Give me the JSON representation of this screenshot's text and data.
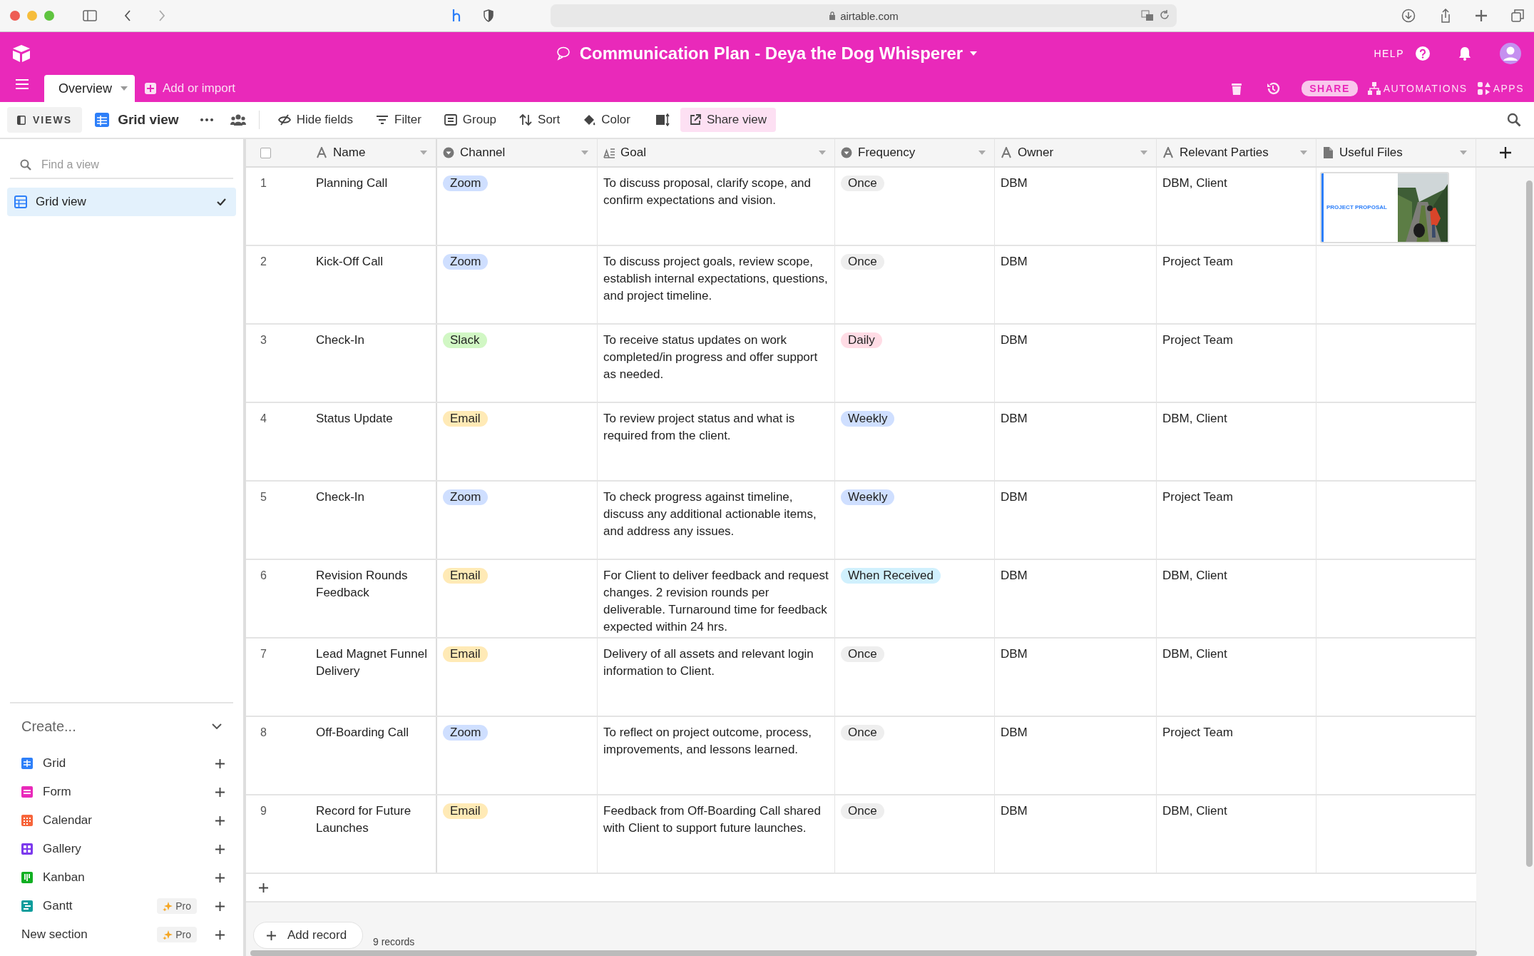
{
  "browser": {
    "url": "airtable.com"
  },
  "header": {
    "title": "Communication Plan - Deya the Dog Whisperer",
    "help": "HELP"
  },
  "tabs": [
    {
      "label": "Overview",
      "selected": true
    }
  ],
  "add_import": "Add or import",
  "header_actions": {
    "share": "SHARE",
    "automations": "AUTOMATIONS",
    "apps": "APPS"
  },
  "toolbar": {
    "views": "VIEWS",
    "view_name": "Grid view",
    "items": [
      {
        "label": "Hide fields",
        "kind": "hide"
      },
      {
        "label": "Filter",
        "kind": "filter"
      },
      {
        "label": "Group",
        "kind": "group"
      },
      {
        "label": "Sort",
        "kind": "sort"
      },
      {
        "label": "Color",
        "kind": "color"
      }
    ],
    "share_view": "Share view"
  },
  "sidebar": {
    "search_placeholder": "Find a view",
    "views": [
      {
        "label": "Grid view",
        "selected": true
      }
    ],
    "create_label": "Create...",
    "create_items": [
      {
        "label": "Grid",
        "kind": "grid",
        "color": "#2d7ff9"
      },
      {
        "label": "Form",
        "kind": "form",
        "color": "#e929ba"
      },
      {
        "label": "Calendar",
        "kind": "calendar",
        "color": "#f7653b"
      },
      {
        "label": "Gallery",
        "kind": "gallery",
        "color": "#7c39ed"
      },
      {
        "label": "Kanban",
        "kind": "kanban",
        "color": "#11af22"
      },
      {
        "label": "Gantt",
        "kind": "gantt",
        "color": "#0d9d9c",
        "badge": "Pro"
      },
      {
        "label": "New section",
        "kind": "section",
        "badge": "Pro"
      }
    ]
  },
  "table": {
    "select_all": {
      "checked": false
    },
    "columns": [
      {
        "label": "Name",
        "kind": "text"
      },
      {
        "label": "Channel",
        "kind": "select"
      },
      {
        "label": "Goal",
        "kind": "longtext"
      },
      {
        "label": "Frequency",
        "kind": "select"
      },
      {
        "label": "Owner",
        "kind": "text"
      },
      {
        "label": "Relevant Parties",
        "kind": "text"
      },
      {
        "label": "Useful Files",
        "kind": "attachment"
      }
    ],
    "rows": [
      {
        "number": "1",
        "name": "Planning Call",
        "channel": {
          "label": "Zoom",
          "color": "#cfdfff"
        },
        "goal": "To discuss proposal, clarify scope, and confirm expectations and vision.",
        "frequency": {
          "label": "Once",
          "color": "#eeeeee"
        },
        "owner": "DBM",
        "parties": "DBM, Client",
        "file": {
          "title": "PROJECT PROPOSAL"
        }
      },
      {
        "number": "2",
        "name": "Kick-Off Call",
        "channel": {
          "label": "Zoom",
          "color": "#cfdfff"
        },
        "goal": "To discuss project goals, review scope, establish internal expectations, questions, and project timeline.",
        "frequency": {
          "label": "Once",
          "color": "#eeeeee"
        },
        "owner": "DBM",
        "parties": "Project Team"
      },
      {
        "number": "3",
        "name": "Check-In",
        "channel": {
          "label": "Slack",
          "color": "#d1f7c4"
        },
        "goal": "To receive status updates on work completed/in progress and offer support as needed.",
        "frequency": {
          "label": "Daily",
          "color": "#ffdce5"
        },
        "owner": "DBM",
        "parties": "Project Team"
      },
      {
        "number": "4",
        "name": "Status Update",
        "channel": {
          "label": "Email",
          "color": "#ffeab6"
        },
        "goal": "To review project status and what is required from the client.",
        "frequency": {
          "label": "Weekly",
          "color": "#cfdfff"
        },
        "owner": "DBM",
        "parties": "DBM, Client"
      },
      {
        "number": "5",
        "name": "Check-In",
        "channel": {
          "label": "Zoom",
          "color": "#cfdfff"
        },
        "goal": "To check progress against timeline, discuss any additional actionable items, and address any issues.",
        "frequency": {
          "label": "Weekly",
          "color": "#cfdfff"
        },
        "owner": "DBM",
        "parties": "Project Team"
      },
      {
        "number": "6",
        "name": "Revision Rounds Feedback",
        "channel": {
          "label": "Email",
          "color": "#ffeab6"
        },
        "goal": "For Client to deliver feedback and request changes. 2 revision rounds per deliverable. Turnaround time for feedback expected within 24 hrs.",
        "frequency": {
          "label": "When Received",
          "color": "#d0f0fd"
        },
        "owner": "DBM",
        "parties": "DBM, Client"
      },
      {
        "number": "7",
        "name": "Lead Magnet Funnel Delivery",
        "channel": {
          "label": "Email",
          "color": "#ffeab6"
        },
        "goal": "Delivery of all assets and relevant login information to Client.",
        "frequency": {
          "label": "Once",
          "color": "#eeeeee"
        },
        "owner": "DBM",
        "parties": "DBM, Client"
      },
      {
        "number": "8",
        "name": "Off-Boarding Call",
        "channel": {
          "label": "Zoom",
          "color": "#cfdfff"
        },
        "goal": "To reflect on project outcome, process, improvements, and lessons learned.",
        "frequency": {
          "label": "Once",
          "color": "#eeeeee"
        },
        "owner": "DBM",
        "parties": "Project Team"
      },
      {
        "number": "9",
        "name": "Record for Future Launches",
        "channel": {
          "label": "Email",
          "color": "#ffeab6"
        },
        "goal": "Feedback from Off-Boarding Call shared with Client to support future launches.",
        "frequency": {
          "label": "Once",
          "color": "#eeeeee"
        },
        "owner": "DBM",
        "parties": "DBM, Client"
      }
    ],
    "footer": {
      "add_record": "Add record",
      "count": "9 records"
    }
  }
}
